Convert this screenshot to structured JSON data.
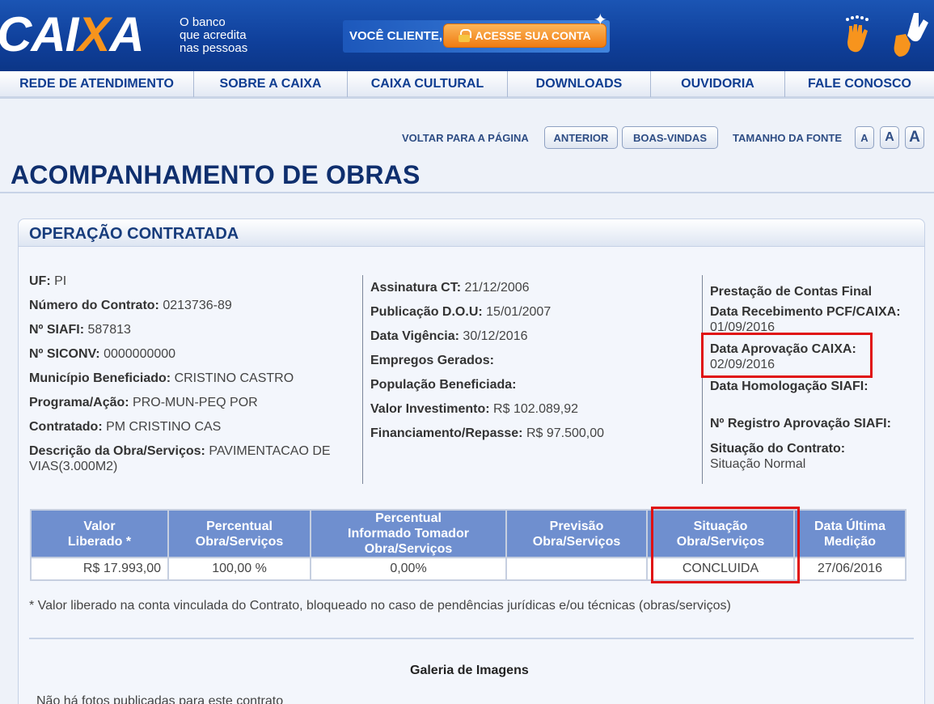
{
  "header": {
    "logo_main": "CAI",
    "logo_x": "X",
    "logo_end": "A",
    "slogan_1": "O banco",
    "slogan_2": "que acredita",
    "slogan_3": "nas pessoas",
    "client_label": "VOCÊ CLIENTE,",
    "access_label": "ACESSE SUA CONTA"
  },
  "nav": [
    "REDE DE ATENDIMENTO",
    "SOBRE A CAIXA",
    "CAIXA CULTURAL",
    "DOWNLOADS",
    "OUVIDORIA",
    "FALE CONOSCO"
  ],
  "utility": {
    "back_label": "VOLTAR PARA A PÁGINA",
    "previous": "ANTERIOR",
    "welcome": "BOAS-VINDAS",
    "font_size_label": "TAMANHO DA FONTE",
    "font_buttons": [
      "A",
      "A",
      "A"
    ]
  },
  "page_title": "ACOMPANHAMENTO DE OBRAS",
  "panel_title": "OPERAÇÃO CONTRATADA",
  "col1": [
    {
      "label": "UF:",
      "value": " PI"
    },
    {
      "label": "Número do Contrato:",
      "value": " 0213736-89"
    },
    {
      "label": "Nº SIAFI:",
      "value": " 587813"
    },
    {
      "label": "Nº SICONV:",
      "value": " 0000000000"
    },
    {
      "label": "Município Beneficiado:",
      "value": " CRISTINO CASTRO"
    },
    {
      "label": "Programa/Ação:",
      "value": " PRO-MUN-PEQ POR"
    },
    {
      "label": "Contratado:",
      "value": " PM CRISTINO CAS"
    },
    {
      "label": "Descrição da Obra/Serviços:",
      "value": " PAVIMENTACAO DE",
      "value2": "VIAS(3.000M2)"
    }
  ],
  "col2": [
    {
      "label": "Assinatura CT:",
      "value": " 21/12/2006"
    },
    {
      "label": "Publicação D.O.U:",
      "value": " 15/01/2007"
    },
    {
      "label": "Data Vigência:",
      "value": " 30/12/2016"
    },
    {
      "label": "Empregos Gerados:",
      "value": ""
    },
    {
      "label": "População Beneficiada:",
      "value": ""
    },
    {
      "label": "Valor Investimento:",
      "value": " R$ 102.089,92"
    },
    {
      "label": "Financiamento/Repasse:",
      "value": " R$ 97.500,00"
    }
  ],
  "col3": {
    "heading": "Prestação de Contas Final",
    "receipt_label": "Data Recebimento PCF/CAIXA:",
    "receipt_value": "01/09/2016",
    "approval_label": "Data Aprovação CAIXA:",
    "approval_value": "02/09/2016",
    "homologation_label": "Data Homologação SIAFI:",
    "registry_label": "Nº Registro Aprovação SIAFI:",
    "status_label": "Situação do Contrato:",
    "status_value": "Situação Normal"
  },
  "table": {
    "headers": [
      [
        "Valor",
        "Liberado *"
      ],
      [
        "Percentual",
        "Obra/Serviços"
      ],
      [
        "Percentual",
        "Informado Tomador",
        "Obra/Serviços"
      ],
      [
        "Previsão",
        "Obra/Serviços"
      ],
      [
        "Situação",
        "Obra/Serviços"
      ],
      [
        "Data Última",
        "Medição"
      ]
    ],
    "row": [
      "R$ 17.993,00",
      "100,00 %",
      "0,00%",
      "",
      "CONCLUIDA",
      "27/06/2016"
    ]
  },
  "footnote": "* Valor liberado na conta vinculada do Contrato, bloqueado no caso de pendências jurídicas e/ou técnicas (obras/serviços)",
  "gallery_title": "Galeria de Imagens",
  "no_photos": "Não há fotos publicadas para este contrato",
  "colors": {
    "brand_blue": "#0f3f9a",
    "accent_orange": "#f7941d",
    "table_header": "#6f8fcf",
    "highlight": "#e01010"
  }
}
